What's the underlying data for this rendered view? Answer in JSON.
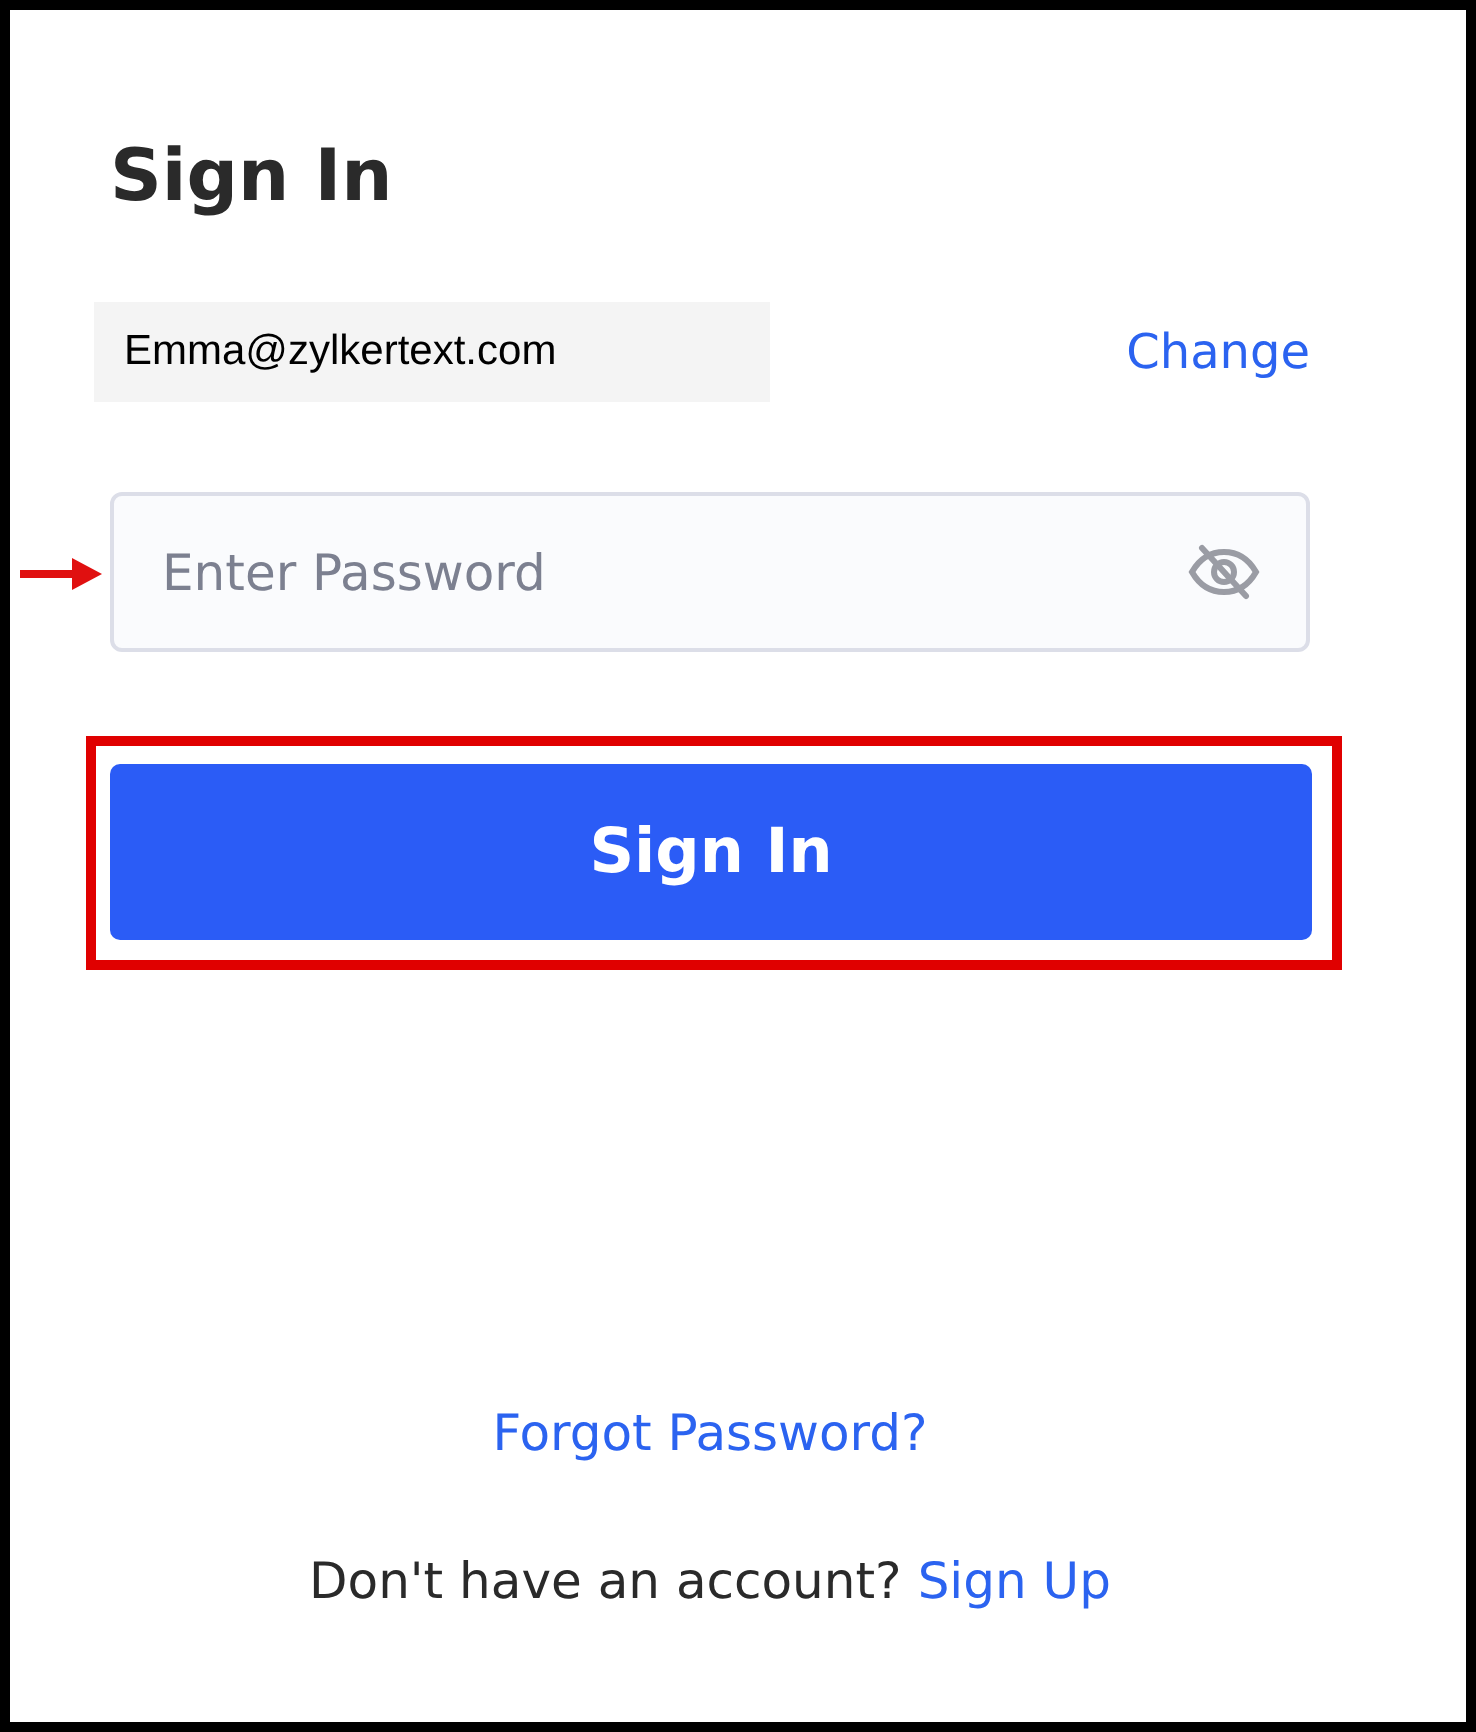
{
  "title": "Sign In",
  "account": {
    "email": "Emma@zylkertext.com",
    "change_link": "Change"
  },
  "password": {
    "placeholder": "Enter Password"
  },
  "sign_in_button": "Sign In",
  "forgot_link": "Forgot Password?",
  "signup": {
    "prompt": "Don't have an account?",
    "link": "Sign Up"
  }
}
